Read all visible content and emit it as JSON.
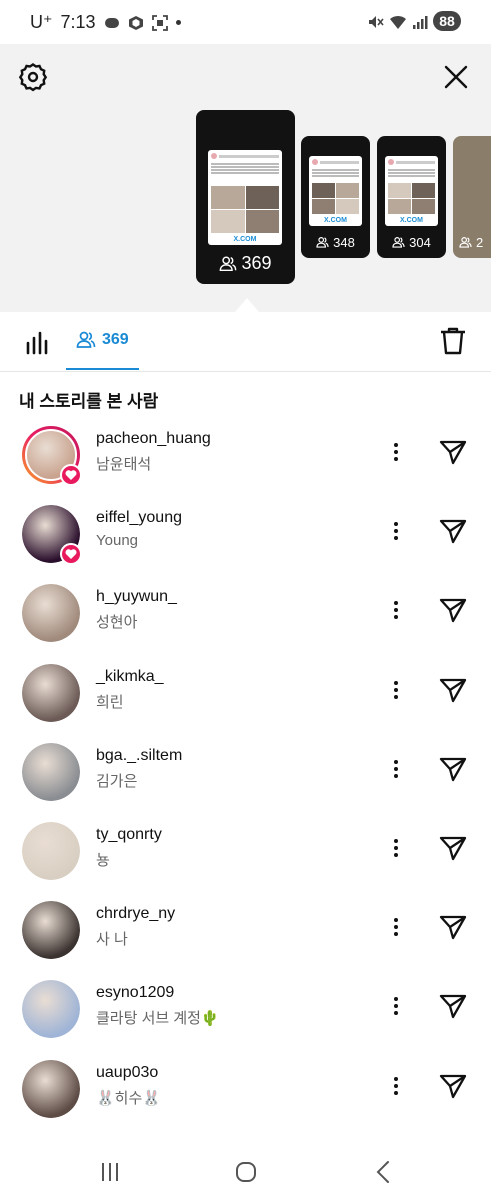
{
  "status_bar": {
    "carrier": "U⁺",
    "time": "7:13",
    "battery": "88",
    "icons": [
      "message-icon",
      "shield-app-icon",
      "screenshot-icon",
      "dot-icon",
      "mute-icon",
      "wifi-icon",
      "signal-icon",
      "battery-icon"
    ]
  },
  "header": {
    "settings_icon": "gear-icon",
    "close_icon": "close-icon"
  },
  "stories": [
    {
      "views": "369",
      "selected": true,
      "card_footer": "X.COM"
    },
    {
      "views": "348",
      "selected": false,
      "card_footer": "X.COM"
    },
    {
      "views": "304",
      "selected": false,
      "card_footer": "X.COM"
    },
    {
      "views": "2",
      "selected": false,
      "card_footer": ""
    }
  ],
  "tabs": {
    "insights_icon": "bar-chart-icon",
    "viewers_count": "369",
    "delete_icon": "trash-icon"
  },
  "section_title": "내 스토리를 본 사람",
  "viewers": [
    {
      "username": "pacheon_huang",
      "name": "남윤태석",
      "liked": true,
      "ring": true,
      "avatar_color": "#c9a38f"
    },
    {
      "username": "eiffel_young",
      "name": "Young",
      "liked": true,
      "ring": false,
      "avatar_color": "#2a0f2c"
    },
    {
      "username": "h_yuywun_",
      "name": "성현아",
      "liked": false,
      "ring": false,
      "avatar_color": "#a08a7c"
    },
    {
      "username": "_kikmka_",
      "name": "희린",
      "liked": false,
      "ring": false,
      "avatar_color": "#6b5a55"
    },
    {
      "username": "bga._.siltem",
      "name": "김가은",
      "liked": false,
      "ring": false,
      "avatar_color": "#8a8d92"
    },
    {
      "username": "ty_qonrty",
      "name": "뇽",
      "liked": false,
      "ring": false,
      "avatar_color": "#d8cfc2"
    },
    {
      "username": "chrdrye_ny",
      "name": "사 나",
      "liked": false,
      "ring": false,
      "avatar_color": "#3b3330"
    },
    {
      "username": "esyno1209",
      "name": "클라탕 서브 계정🌵",
      "liked": false,
      "ring": false,
      "avatar_color": "#9fb4d6"
    },
    {
      "username": "uaup03o",
      "name": "🐰히수🐰",
      "liked": false,
      "ring": false,
      "avatar_color": "#5d4b45"
    }
  ],
  "nav": {
    "recents_icon": "recents-icon",
    "home_icon": "home-icon",
    "back_icon": "back-icon"
  }
}
